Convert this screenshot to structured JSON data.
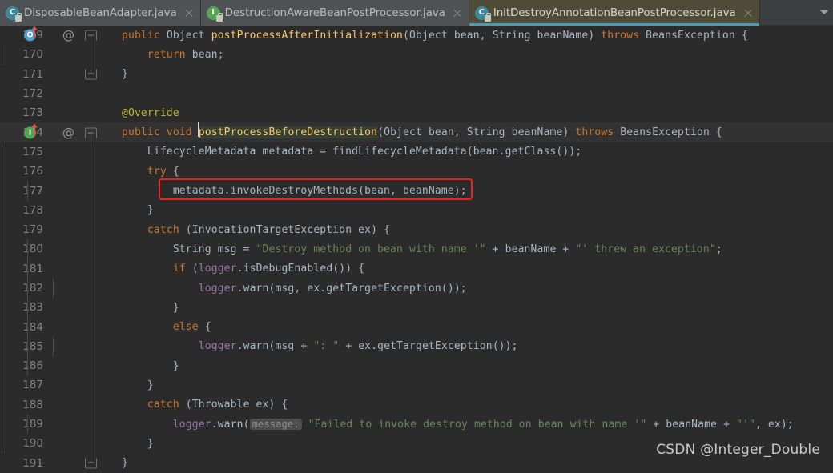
{
  "window": {
    "app": "IntelliJ IDEA Editor",
    "theme_colors": {
      "editor_background": "#2b2b2b",
      "tabbar_background": "#3c3f41",
      "active_tab_background": "#4e4b36",
      "active_tab_underline": "#4a9cb5",
      "keyword": "#cc7832",
      "method": "#ffc66d",
      "string": "#6a8759",
      "field": "#9876aa",
      "annotation": "#bbb529",
      "default_text": "#a9b7c6",
      "line_number": "#868686",
      "annotation_box": "#ee2222",
      "current_line": "#323232"
    }
  },
  "tabs": [
    {
      "label": "DisposableBeanAdapter.java",
      "icon": "java-class-icon",
      "icon_letter": "C",
      "icon_kind": "cls",
      "active": false,
      "closable": true
    },
    {
      "label": "DestructionAwareBeanPostProcessor.java",
      "icon": "java-interface-icon",
      "icon_letter": "I",
      "icon_kind": "iface",
      "active": false,
      "closable": true
    },
    {
      "label": "InitDestroyAnnotationBeanPostProcessor.java",
      "icon": "java-class-icon",
      "icon_letter": "C",
      "icon_kind": "cls",
      "active": true,
      "closable": true
    }
  ],
  "tabbar": {
    "overflow_icon": "chevron-down-icon"
  },
  "editor": {
    "first_line": 169,
    "last_line": 191,
    "lines": [
      {
        "number": "169",
        "indent": 0,
        "gutter_marker": "overriding-method-icon",
        "marker_letter": "O",
        "marker_kind": "over",
        "at_sign": "@",
        "fold": "start",
        "current": false,
        "tokens": [
          {
            "t": "public",
            "c": "kw"
          },
          {
            "t": " ",
            "c": "txt"
          },
          {
            "t": "Object",
            "c": "txt"
          },
          {
            "t": " ",
            "c": "txt"
          },
          {
            "t": "postProcessAfterInitialization",
            "c": "mth"
          },
          {
            "t": "(Object bean, String beanName) ",
            "c": "txt"
          },
          {
            "t": "throws",
            "c": "kw"
          },
          {
            "t": " BeansException {",
            "c": "txt"
          }
        ]
      },
      {
        "number": "170",
        "indent": 1,
        "fold": "line",
        "current": false,
        "tokens": [
          {
            "t": "    ",
            "c": "txt"
          },
          {
            "t": "return",
            "c": "kw"
          },
          {
            "t": " bean;",
            "c": "txt"
          }
        ]
      },
      {
        "number": "171",
        "indent": 0,
        "fold": "end",
        "current": false,
        "tokens": [
          {
            "t": "}",
            "c": "txt"
          }
        ]
      },
      {
        "number": "172",
        "indent": 0,
        "fold": "none",
        "current": false,
        "tokens": []
      },
      {
        "number": "173",
        "indent": 0,
        "fold": "none",
        "current": false,
        "tokens": [
          {
            "t": "@Override",
            "c": "ann"
          }
        ]
      },
      {
        "number": "174",
        "indent": 0,
        "gutter_marker": "implementing-method-icon",
        "marker_letter": "I",
        "marker_kind": "impl",
        "at_sign": "@",
        "fold": "start",
        "current": true,
        "tokens": [
          {
            "t": "public",
            "c": "kw"
          },
          {
            "t": " ",
            "c": "txt"
          },
          {
            "t": "void",
            "c": "kw"
          },
          {
            "t": " ",
            "c": "txt"
          },
          {
            "t": "postProcessBeforeDestruction",
            "c": "mth caret-ident"
          },
          {
            "t": "(Object bean, String beanName) ",
            "c": "txt"
          },
          {
            "t": "throws",
            "c": "kw"
          },
          {
            "t": " BeansException {",
            "c": "txt"
          }
        ]
      },
      {
        "number": "175",
        "indent": 1,
        "fold": "line",
        "current": false,
        "tokens": [
          {
            "t": "    LifecycleMetadata metadata = findLifecycleMetadata(bean.getClass());",
            "c": "txt"
          }
        ]
      },
      {
        "number": "176",
        "indent": 1,
        "fold": "line",
        "current": false,
        "tokens": [
          {
            "t": "    ",
            "c": "txt"
          },
          {
            "t": "try",
            "c": "kw"
          },
          {
            "t": " {",
            "c": "txt"
          }
        ]
      },
      {
        "number": "177",
        "indent": 2,
        "fold": "line",
        "current": false,
        "boxed": true,
        "tokens": [
          {
            "t": "        metadata.invokeDestroyMethods(bean, beanName);",
            "c": "txt"
          }
        ]
      },
      {
        "number": "178",
        "indent": 1,
        "fold": "line",
        "current": false,
        "tokens": [
          {
            "t": "    }",
            "c": "txt"
          }
        ]
      },
      {
        "number": "179",
        "indent": 1,
        "fold": "line",
        "current": false,
        "tokens": [
          {
            "t": "    ",
            "c": "txt"
          },
          {
            "t": "catch",
            "c": "kw"
          },
          {
            "t": " (InvocationTargetException ex) {",
            "c": "txt"
          }
        ]
      },
      {
        "number": "180",
        "indent": 2,
        "fold": "line",
        "current": false,
        "tokens": [
          {
            "t": "        String msg = ",
            "c": "txt"
          },
          {
            "t": "\"Destroy method on bean with name '\"",
            "c": "str"
          },
          {
            "t": " + beanName + ",
            "c": "txt"
          },
          {
            "t": "\"' threw an exception\"",
            "c": "str"
          },
          {
            "t": ";",
            "c": "txt"
          }
        ]
      },
      {
        "number": "181",
        "indent": 2,
        "fold": "line",
        "current": false,
        "tokens": [
          {
            "t": "        ",
            "c": "txt"
          },
          {
            "t": "if",
            "c": "kw"
          },
          {
            "t": " (",
            "c": "txt"
          },
          {
            "t": "logger",
            "c": "fld"
          },
          {
            "t": ".isDebugEnabled()) {",
            "c": "txt"
          }
        ]
      },
      {
        "number": "182",
        "indent": 3,
        "fold": "line",
        "current": false,
        "tokens": [
          {
            "t": "            ",
            "c": "txt"
          },
          {
            "t": "logger",
            "c": "fld"
          },
          {
            "t": ".warn(msg, ex.getTargetException());",
            "c": "txt"
          }
        ]
      },
      {
        "number": "183",
        "indent": 2,
        "fold": "line",
        "current": false,
        "tokens": [
          {
            "t": "        }",
            "c": "txt"
          }
        ]
      },
      {
        "number": "184",
        "indent": 2,
        "fold": "line",
        "current": false,
        "tokens": [
          {
            "t": "        ",
            "c": "txt"
          },
          {
            "t": "else",
            "c": "kw"
          },
          {
            "t": " {",
            "c": "txt"
          }
        ]
      },
      {
        "number": "185",
        "indent": 3,
        "fold": "line",
        "current": false,
        "tokens": [
          {
            "t": "            ",
            "c": "txt"
          },
          {
            "t": "logger",
            "c": "fld"
          },
          {
            "t": ".warn(msg + ",
            "c": "txt"
          },
          {
            "t": "\": \"",
            "c": "str"
          },
          {
            "t": " + ex.getTargetException());",
            "c": "txt"
          }
        ]
      },
      {
        "number": "186",
        "indent": 2,
        "fold": "line",
        "current": false,
        "tokens": [
          {
            "t": "        }",
            "c": "txt"
          }
        ]
      },
      {
        "number": "187",
        "indent": 1,
        "fold": "line",
        "current": false,
        "tokens": [
          {
            "t": "    }",
            "c": "txt"
          }
        ]
      },
      {
        "number": "188",
        "indent": 1,
        "fold": "line",
        "current": false,
        "tokens": [
          {
            "t": "    ",
            "c": "txt"
          },
          {
            "t": "catch",
            "c": "kw"
          },
          {
            "t": " (Throwable ex) {",
            "c": "txt"
          }
        ]
      },
      {
        "number": "189",
        "indent": 2,
        "fold": "line",
        "current": false,
        "tokens": [
          {
            "t": "        ",
            "c": "txt"
          },
          {
            "t": "logger",
            "c": "fld"
          },
          {
            "t": ".warn(",
            "c": "txt"
          },
          {
            "t": "message:",
            "c": "hint"
          },
          {
            "t": " ",
            "c": "txt"
          },
          {
            "t": "\"Failed to invoke destroy method on bean with name '\"",
            "c": "str"
          },
          {
            "t": " + beanName + ",
            "c": "txt"
          },
          {
            "t": "\"'\"",
            "c": "str"
          },
          {
            "t": ", ex);",
            "c": "txt"
          }
        ]
      },
      {
        "number": "190",
        "indent": 1,
        "fold": "line",
        "current": false,
        "tokens": [
          {
            "t": "    }",
            "c": "txt"
          }
        ]
      },
      {
        "number": "191",
        "indent": 0,
        "fold": "end",
        "current": false,
        "tokens": [
          {
            "t": "}",
            "c": "txt"
          }
        ]
      }
    ]
  },
  "annotations": {
    "highlight_box": {
      "kind": "red-rectangle-annotation",
      "target_line": "177",
      "target_text": "metadata.invokeDestroyMethods(bean, beanName);",
      "color": "#ee2222"
    }
  },
  "watermark": {
    "text": "CSDN @Integer_Double"
  }
}
